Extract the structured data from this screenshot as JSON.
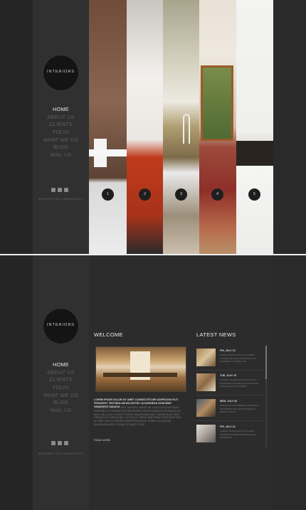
{
  "logo_text": "INTERIORS",
  "nav": [
    "HOME",
    "ABOUT US",
    "CLIENTS",
    "FOLIO",
    "WHAT WE DO",
    "BLOG",
    "MAIL US"
  ],
  "copyright": "INTERIORS © 2011 • PRIVACY POLICY",
  "slides": [
    "1",
    "2",
    "3",
    "4",
    "5"
  ],
  "welcome": {
    "title": "WELCOME",
    "bold": "LOREM IPSUM DOLOR SIT AMET CONSECTETUER ADIPISCING ELIT. PRAESENT VESTIBULUM MOLESTIE LACUSENEAN NONUMMY HENDRERIT MAURIS.",
    "text": "PHASELLUS PORTA. FUSCE SUSCIPIT VARIUS MI. CUM SOCIIS NATOQUE PENATIBUS ET MAGNIS DIS PARTURIENT MONTES NASCETUR RIDICULUS MUS. NULLA DUI. FUSCE FEUGIAT MALESUADA ODIO. MORBI NUNC ODIO GRAVIDA AT CURSUS NEC LUCTUS A LOREM. MAECENAS TRISTIQUE ORCI AC SEM. DUIS ULTRICIES PHARETRA MAGNA. DONEC ACCUMSAN MALESUADA ORCI. DONEC SIT AMET EROS.",
    "more": "READ MORE"
  },
  "latest": {
    "title": "LATEST NEWS",
    "items": [
      {
        "date": "FRI, JULY 15",
        "text": "LOREM IPSUM DOLOR SIT AMET CONSECTETUER ADIPISCING ELIT PRAESENT VESTIBULUM"
      },
      {
        "date": "TUE, JULY 19",
        "text": "CONSECTETUER ADIPISCING ELIT PRAESENT VESTIBULUM MOLESTIE LACUSENEAN NONUMMY"
      },
      {
        "date": "WED, JULY 20",
        "text": "MOLESTIE LACUSENEAN NONUMMY HENDRERIT MAURIS PHASELLUS PORTA FUSCE"
      },
      {
        "date": "FRI, JULY 22",
        "text": "LOREM IPSUM DOLOR SIT AMET CONSECTETUER ADIPISCING ELIT PRAESENT"
      }
    ]
  }
}
